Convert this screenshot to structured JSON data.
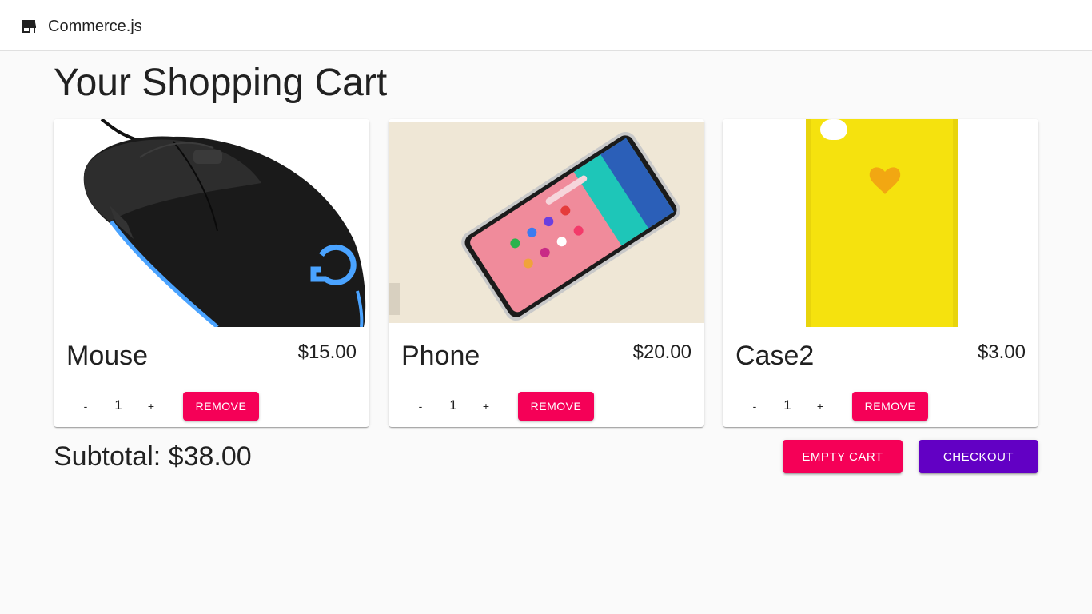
{
  "header": {
    "brand_name": "Commerce.js",
    "brand_icon": "store-icon"
  },
  "page": {
    "title": "Your Shopping Cart"
  },
  "cart": {
    "items": [
      {
        "name": "Mouse",
        "price": "$15.00",
        "quantity": "1",
        "decrement_label": "-",
        "increment_label": "+",
        "remove_label": "REMOVE",
        "image": "mouse-image"
      },
      {
        "name": "Phone",
        "price": "$20.00",
        "quantity": "1",
        "decrement_label": "-",
        "increment_label": "+",
        "remove_label": "REMOVE",
        "image": "phone-image"
      },
      {
        "name": "Case2",
        "price": "$3.00",
        "quantity": "1",
        "decrement_label": "-",
        "increment_label": "+",
        "remove_label": "REMOVE",
        "image": "case-image"
      }
    ],
    "subtotal": "Subtotal: $38.00",
    "empty_label": "EMPTY CART",
    "checkout_label": "CHECKOUT"
  },
  "colors": {
    "secondary": "#f50057",
    "primary": "#6200c4",
    "background": "#fafafa"
  }
}
